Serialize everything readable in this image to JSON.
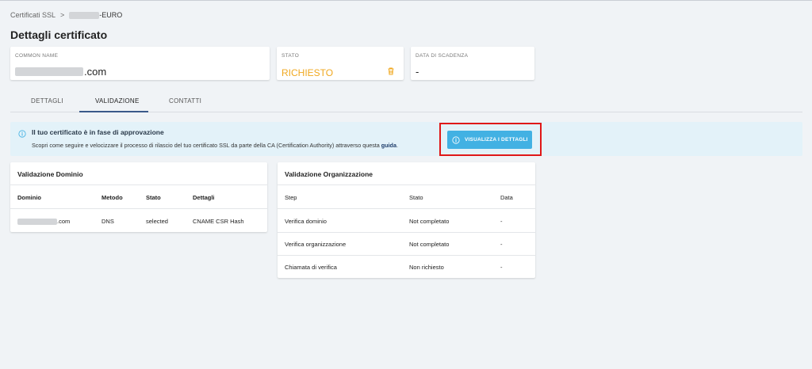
{
  "breadcrumb": {
    "root": "Certificati SSL",
    "separator": ">",
    "current_suffix": "-EURO"
  },
  "page_title": "Dettagli certificato",
  "cards": {
    "common_name": {
      "label": "COMMON NAME",
      "value_suffix": ".com"
    },
    "status": {
      "label": "STATO",
      "value": "RICHIESTO"
    },
    "expiry": {
      "label": "DATA DI SCADENZA",
      "value": "-"
    }
  },
  "tabs": [
    {
      "label": "DETTAGLI"
    },
    {
      "label": "VALIDAZIONE"
    },
    {
      "label": "CONTATTI"
    }
  ],
  "banner": {
    "title": "Il tuo certificato è in fase di approvazione",
    "text": "Scopri come seguire e velocizzare il processo di rilascio del tuo certificato SSL da parte della CA (Certification Authority) attraverso questa",
    "link": "guida",
    "link_suffix": ".",
    "button_label": "VISUALIZZA I DETTAGLI"
  },
  "domain_validation": {
    "title": "Validazione Dominio",
    "headers": [
      "Dominio",
      "Metodo",
      "Stato",
      "Dettagli"
    ],
    "rows": [
      {
        "domain_suffix": ".com",
        "method": "DNS",
        "status": "selected",
        "details": "CNAME CSR Hash"
      }
    ]
  },
  "org_validation": {
    "title": "Validazione Organizzazione",
    "headers": [
      "Step",
      "Stato",
      "Data"
    ],
    "rows": [
      {
        "step": "Verifica dominio",
        "status": "Not completato",
        "date": "-"
      },
      {
        "step": "Verifica organizzazione",
        "status": "Not completato",
        "date": "-"
      },
      {
        "step": "Chiamata di verifica",
        "status": "Non richiesto",
        "date": "-"
      }
    ]
  },
  "colors": {
    "accent": "#42b1e3",
    "status": "#f0a820",
    "highlight": "#e01818",
    "tab_active": "#3b5a8a"
  }
}
